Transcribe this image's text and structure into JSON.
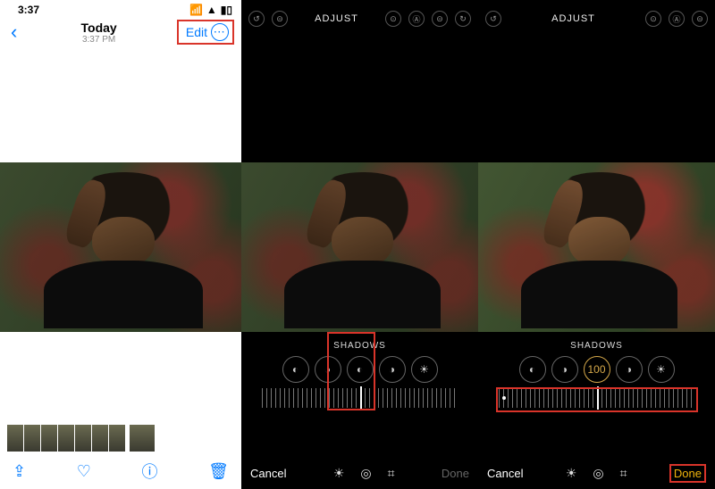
{
  "panel1": {
    "status_time": "3:37",
    "title": "Today",
    "subtitle": "3:37 PM",
    "edit_label": "Edit",
    "more_glyph": "···",
    "toolbar": {
      "share": "⇪",
      "heart": "♡",
      "info": "ⓘ",
      "trash": "🗑"
    }
  },
  "panel2": {
    "adjust_label": "ADJUST",
    "caption": "SHADOWS",
    "cancel": "Cancel",
    "done": "Done",
    "adj_icons": [
      "◐",
      "◑",
      "◐",
      "◑",
      "☀"
    ]
  },
  "panel3": {
    "adjust_label": "ADJUST",
    "caption": "SHADOWS",
    "selected_value": "100",
    "cancel": "Cancel",
    "done": "Done",
    "adj_icons": [
      "◐",
      "◑",
      "100",
      "◑",
      "☀"
    ]
  },
  "edit_top_icons": [
    "↺",
    "⊝",
    "⊙",
    "⊝",
    "↻"
  ]
}
